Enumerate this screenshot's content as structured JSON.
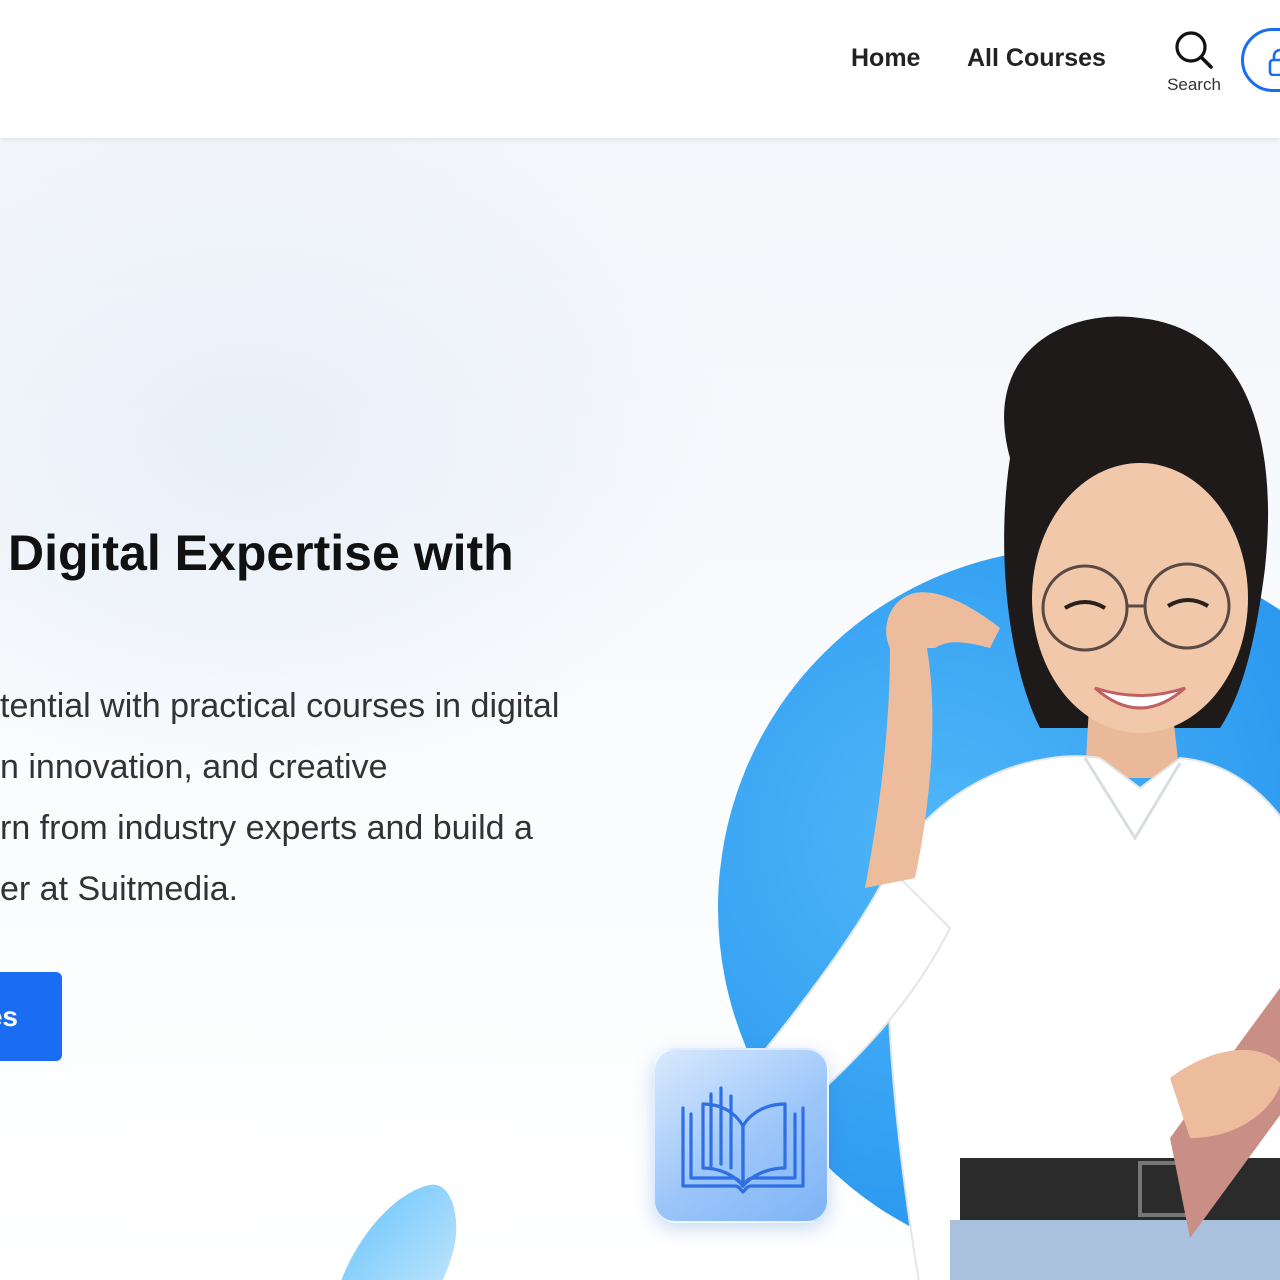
{
  "header": {
    "nav": [
      {
        "label": "Home"
      },
      {
        "label": "All Courses"
      }
    ],
    "search_label": "Search",
    "login_icon": "lock-icon"
  },
  "hero": {
    "title": "Digital Expertise with",
    "description_lines": [
      "tential with practical courses in digital",
      "n innovation, and creative",
      "rn from industry experts and build a",
      "er at Suitmedia."
    ],
    "cta_label": "es",
    "book_icon": "open-book-icon"
  },
  "colors": {
    "accent": "#1a6df2",
    "circle": "#2f9cf1",
    "book_card": "#9cc6fa"
  }
}
